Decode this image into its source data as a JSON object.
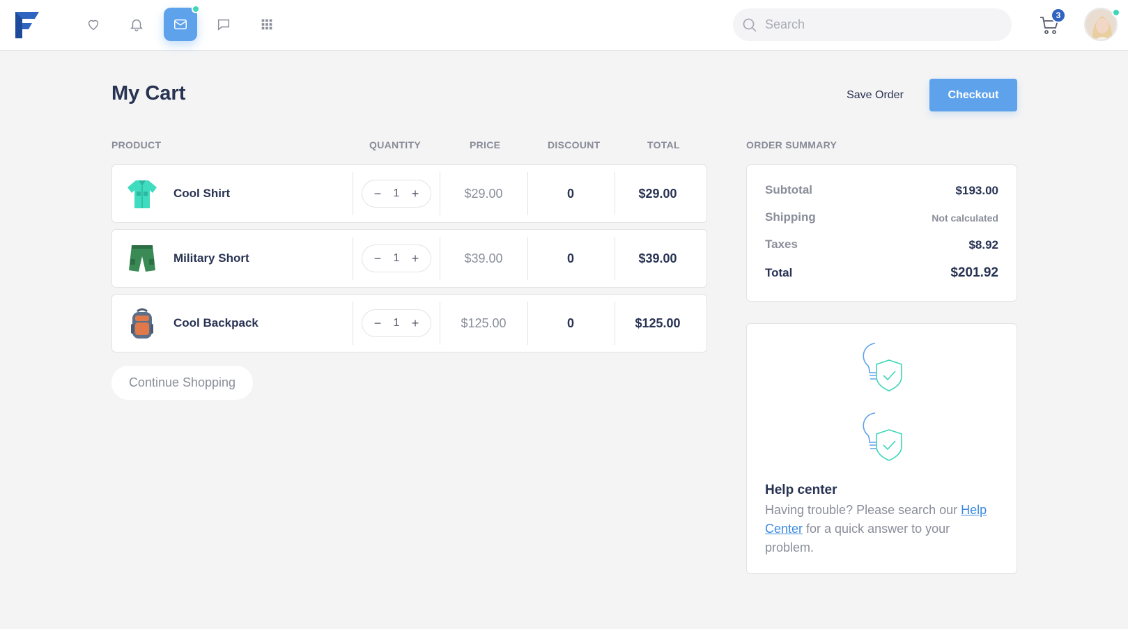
{
  "brand": {
    "logo_icon": "brand-f-logo",
    "primary_color": "#5ea2ec",
    "accent_color": "#3dd6b8",
    "badge_color": "#2f64c0"
  },
  "nav": {
    "icons": [
      "heart-icon",
      "bell-icon",
      "mail-icon",
      "chat-icon",
      "apps-grid-icon"
    ],
    "active": "mail-icon"
  },
  "search": {
    "placeholder": "Search"
  },
  "cart": {
    "count": "3"
  },
  "page": {
    "title": "My Cart",
    "save_order_label": "Save Order",
    "checkout_label": "Checkout"
  },
  "table": {
    "headers": {
      "product": "PRODUCT",
      "quantity": "QUANTITY",
      "price": "PRICE",
      "discount": "DISCOUNT",
      "total": "TOTAL"
    },
    "rows": [
      {
        "name": "Cool Shirt",
        "qty": "1",
        "price": "$29.00",
        "discount": "0",
        "total": "$29.00",
        "icon": "shirt-icon"
      },
      {
        "name": "Military Short",
        "qty": "1",
        "price": "$39.00",
        "discount": "0",
        "total": "$39.00",
        "icon": "shorts-icon"
      },
      {
        "name": "Cool Backpack",
        "qty": "1",
        "price": "$125.00",
        "discount": "0",
        "total": "$125.00",
        "icon": "backpack-icon"
      }
    ],
    "qty_minus": "−",
    "qty_plus": "+"
  },
  "continue_label": "Continue Shopping",
  "summary": {
    "heading": "ORDER SUMMARY",
    "subtotal_label": "Subtotal",
    "subtotal_value": "$193.00",
    "shipping_label": "Shipping",
    "shipping_value": "Not calculated",
    "taxes_label": "Taxes",
    "taxes_value": "$8.92",
    "total_label": "Total",
    "total_value": "$201.92"
  },
  "help": {
    "title": "Help center",
    "text_before": "Having trouble? Please search our ",
    "link": "Help Center",
    "text_after": " for a quick answer to your problem."
  }
}
